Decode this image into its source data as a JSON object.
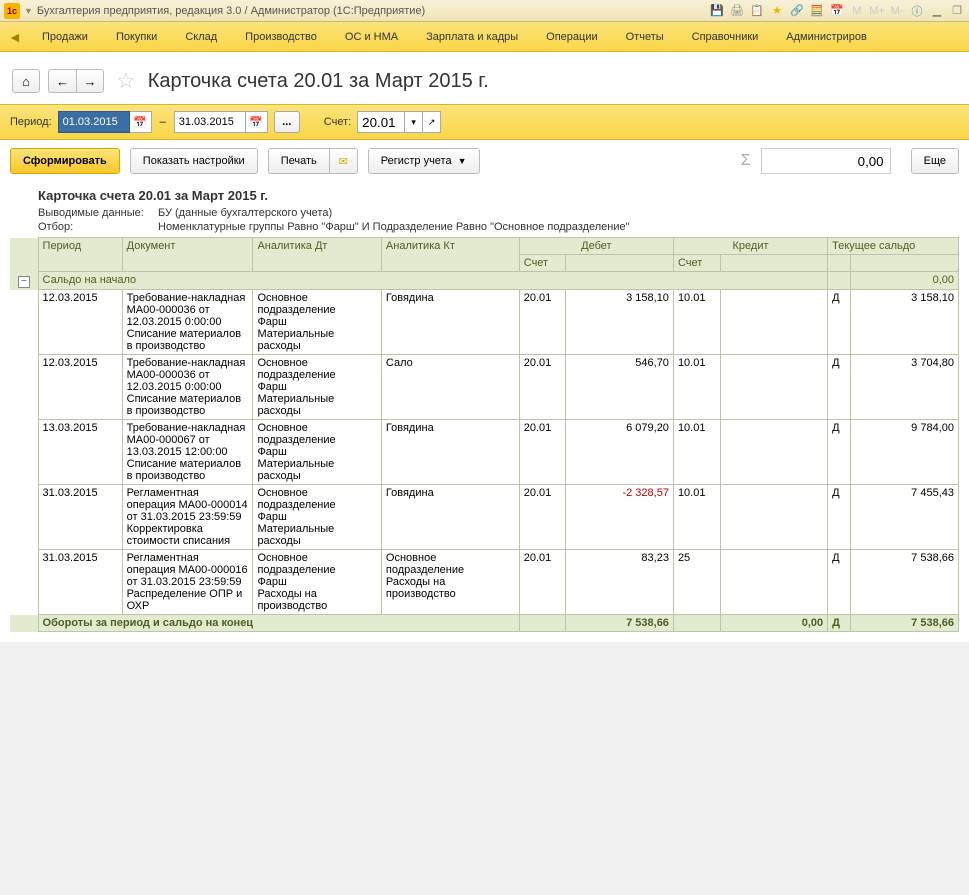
{
  "titlebar": {
    "text": "Бухгалтерия предприятия, редакция 3.0 / Администратор  (1С:Предприятие)"
  },
  "menu": {
    "items": [
      "Продажи",
      "Покупки",
      "Склад",
      "Производство",
      "ОС и НМА",
      "Зарплата и кадры",
      "Операции",
      "Отчеты",
      "Справочники",
      "Администриров"
    ]
  },
  "page": {
    "title": "Карточка счета 20.01 за Март 2015 г."
  },
  "period": {
    "label": "Период:",
    "from": "01.03.2015",
    "to": "31.03.2015",
    "account_label": "Счет:",
    "account": "20.01"
  },
  "actions": {
    "generate": "Сформировать",
    "settings": "Показать настройки",
    "print": "Печать",
    "register": "Регистр учета",
    "more": "Еще",
    "sum": "0,00"
  },
  "report": {
    "title": "Карточка счета 20.01 за Март 2015 г.",
    "output_label": "Выводимые данные:",
    "output": "БУ (данные бухгалтерского учета)",
    "filter_label": "Отбор:",
    "filter": "Номенклатурные группы Равно \"Фарш\" И Подразделение Равно \"Основное подразделение\"",
    "columns": {
      "period": "Период",
      "doc": "Документ",
      "adt": "Аналитика Дт",
      "akt": "Аналитика Кт",
      "debit": "Дебет",
      "credit": "Кредит",
      "balance": "Текущее сальдо",
      "account": "Счет"
    },
    "opening": {
      "label": "Сальдо на начало",
      "value": "0,00"
    },
    "rows": [
      {
        "period": "12.03.2015",
        "doc": "Требование-накладная МА00-000036 от 12.03.2015 0:00:00\nСписание материалов в производство",
        "adt": "Основное подразделение\nФарш\nМатериальные расходы",
        "akt": "Говядина",
        "dacct": "20.01",
        "damt": "3 158,10",
        "cacct": "10.01",
        "camt": "",
        "dc": "Д",
        "bal": "3 158,10"
      },
      {
        "period": "12.03.2015",
        "doc": "Требование-накладная МА00-000036 от 12.03.2015 0:00:00\nСписание материалов в производство",
        "adt": "Основное подразделение\nФарш\nМатериальные расходы",
        "akt": "Сало",
        "dacct": "20.01",
        "damt": "546,70",
        "cacct": "10.01",
        "camt": "",
        "dc": "Д",
        "bal": "3 704,80"
      },
      {
        "period": "13.03.2015",
        "doc": "Требование-накладная МА00-000067 от 13.03.2015 12:00:00\nСписание материалов в производство",
        "adt": "Основное подразделение\nФарш\nМатериальные расходы",
        "akt": "Говядина",
        "dacct": "20.01",
        "damt": "6 079,20",
        "cacct": "10.01",
        "camt": "",
        "dc": "Д",
        "bal": "9 784,00"
      },
      {
        "period": "31.03.2015",
        "doc": "Регламентная операция МА00-000014 от 31.03.2015 23:59:59\nКорректировка стоимости списания",
        "adt": "Основное подразделение\nФарш\nМатериальные расходы",
        "akt": "Говядина",
        "dacct": "20.01",
        "damt": "-2 328,57",
        "damt_neg": true,
        "cacct": "10.01",
        "camt": "",
        "dc": "Д",
        "bal": "7 455,43"
      },
      {
        "period": "31.03.2015",
        "doc": "Регламентная операция МА00-000016 от 31.03.2015 23:59:59\nРаспределение ОПР и ОХР",
        "adt": "Основное подразделение\nФарш\nРасходы на производство",
        "akt": "Основное подразделение\nРасходы на производство",
        "dacct": "20.01",
        "damt": "83,23",
        "cacct": "25",
        "camt": "",
        "dc": "Д",
        "bal": "7 538,66"
      }
    ],
    "totals": {
      "label": "Обороты за период и сальдо на конец",
      "debit": "7 538,66",
      "credit": "0,00",
      "dc": "Д",
      "bal": "7 538,66"
    }
  }
}
